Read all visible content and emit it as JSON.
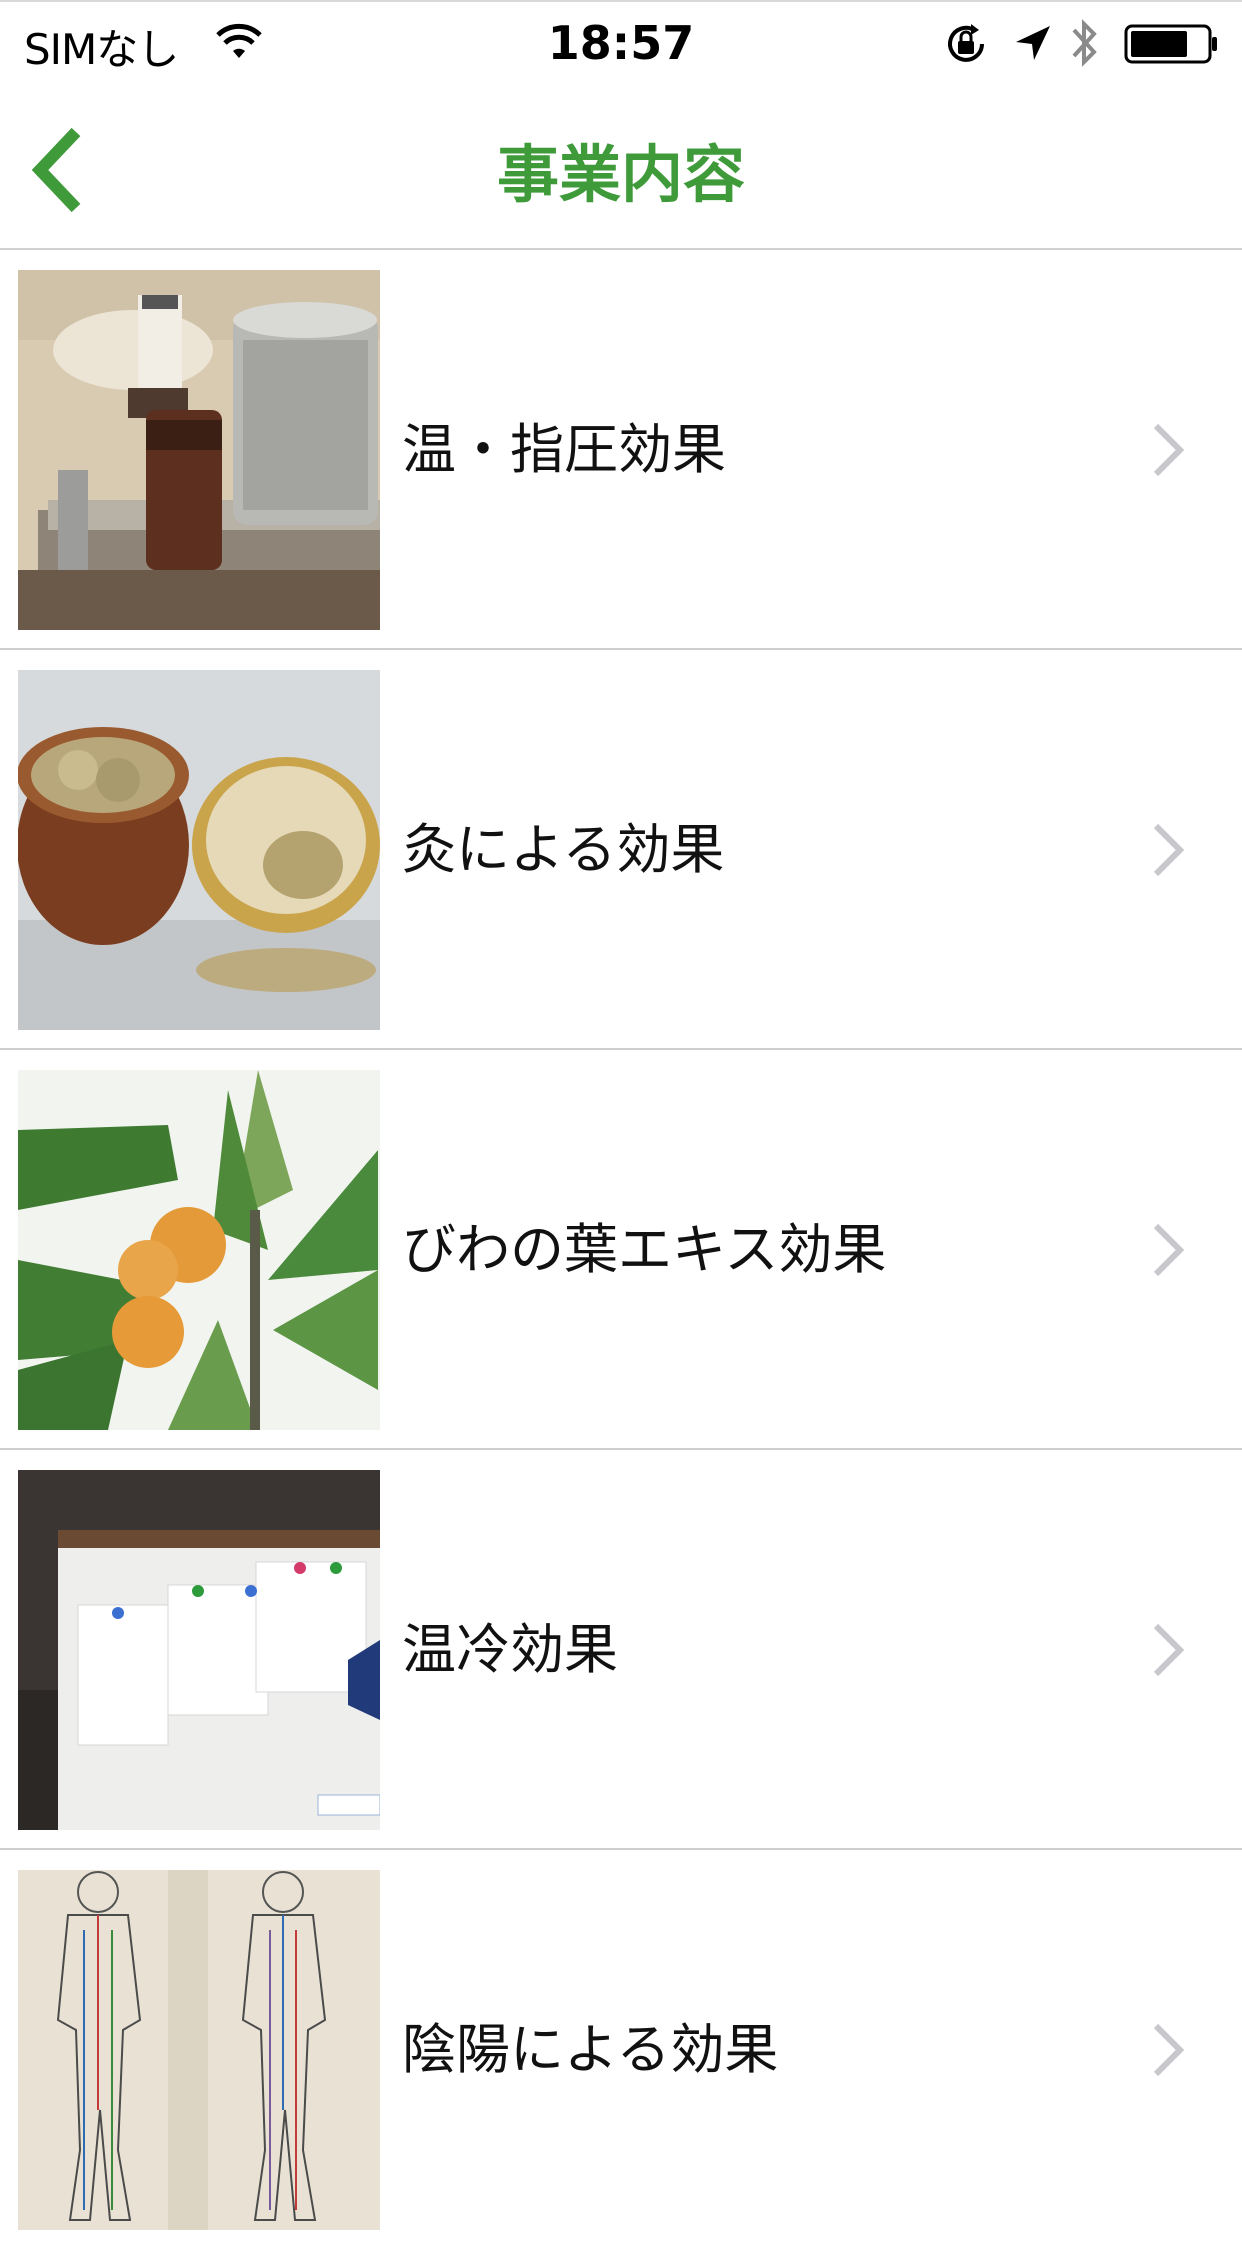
{
  "status_bar": {
    "carrier": "SIMなし",
    "time": "18:57",
    "icons": [
      "wifi-icon",
      "orientation-lock-icon",
      "location-arrow-icon",
      "bluetooth-icon",
      "battery-icon"
    ]
  },
  "nav": {
    "title": "事業内容",
    "back_icon": "chevron-left-icon",
    "accent_color": "#3f9a3a"
  },
  "list": {
    "items": [
      {
        "label": "温・指圧効果",
        "image": "heating-apparatus-photo"
      },
      {
        "label": "灸による効果",
        "image": "moxa-containers-photo"
      },
      {
        "label": "びわの葉エキス効果",
        "image": "loquat-fruit-leaves-photo"
      },
      {
        "label": "温冷効果",
        "image": "handwritten-notes-board-photo"
      },
      {
        "label": "陰陽による効果",
        "image": "acupuncture-meridian-chart-photo"
      }
    ],
    "row_icon": "chevron-right-icon"
  }
}
